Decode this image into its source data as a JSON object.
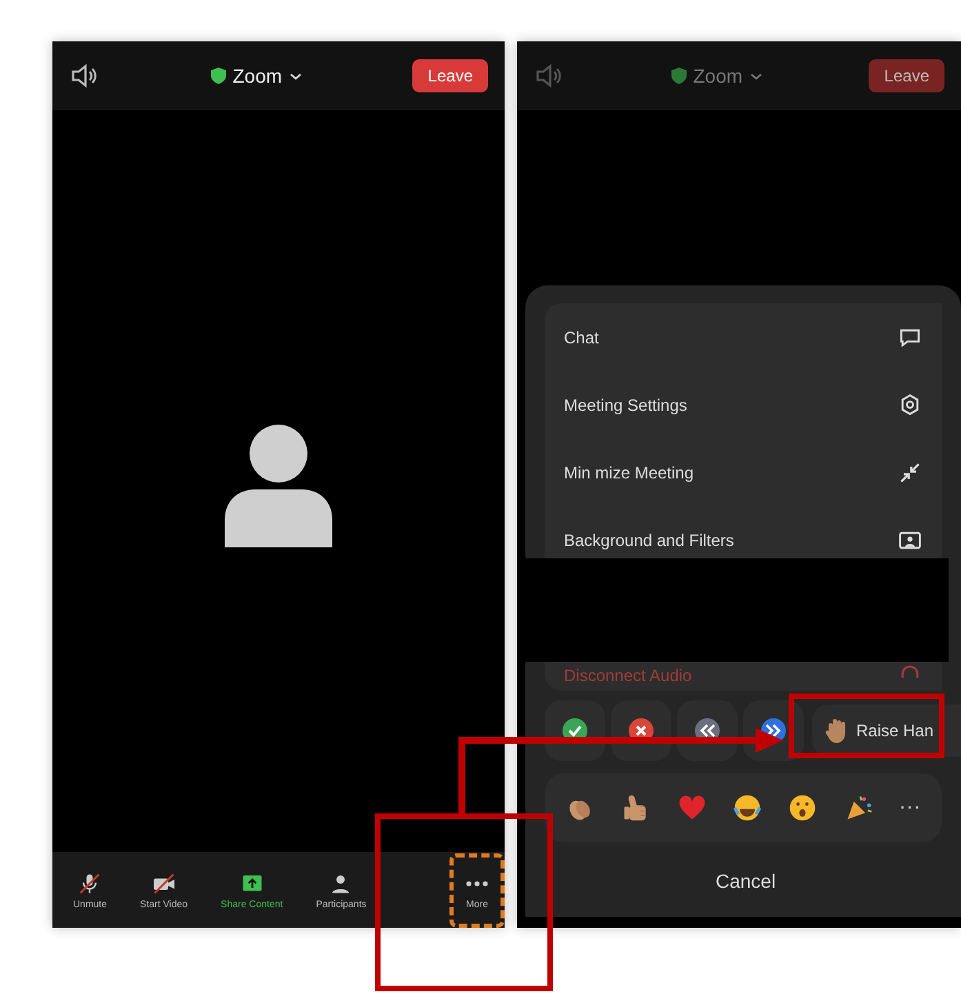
{
  "left_phone": {
    "top_bar": {
      "title": "Zoom",
      "leave": "Leave"
    },
    "toolbar": [
      {
        "kind": "mic",
        "label": "Unmute",
        "off": true,
        "highlighted": false
      },
      {
        "kind": "video",
        "label": "Start Video",
        "off": true,
        "highlighted": false
      },
      {
        "kind": "share",
        "label": "Share Content",
        "off": false,
        "highlighted": false
      },
      {
        "kind": "participants",
        "label": "Participants",
        "off": false,
        "highlighted": false
      },
      {
        "kind": "more",
        "label": "More",
        "off": false,
        "highlighted": true
      }
    ]
  },
  "right_phone": {
    "top_bar": {
      "title": "Zoom",
      "leave": "Leave"
    },
    "menu": [
      {
        "kind": "chat",
        "label": "Chat"
      },
      {
        "kind": "settings",
        "label": "Meeting Settings"
      },
      {
        "kind": "minimize",
        "label": "Min mize Meeting"
      },
      {
        "kind": "background",
        "label": "Background and Filters"
      },
      {
        "kind": "disconnect",
        "label": "Disconnect Audio"
      }
    ],
    "feedback": [
      {
        "kind": "yes"
      },
      {
        "kind": "no"
      },
      {
        "kind": "slower"
      },
      {
        "kind": "faster"
      }
    ],
    "raise_hand": "Raise Han",
    "reactions": [
      {
        "kind": "clap"
      },
      {
        "kind": "thumbs-up"
      },
      {
        "kind": "heart"
      },
      {
        "kind": "joy"
      },
      {
        "kind": "wow"
      },
      {
        "kind": "tada"
      }
    ],
    "more_reactions": "···",
    "cancel": "Cancel"
  }
}
